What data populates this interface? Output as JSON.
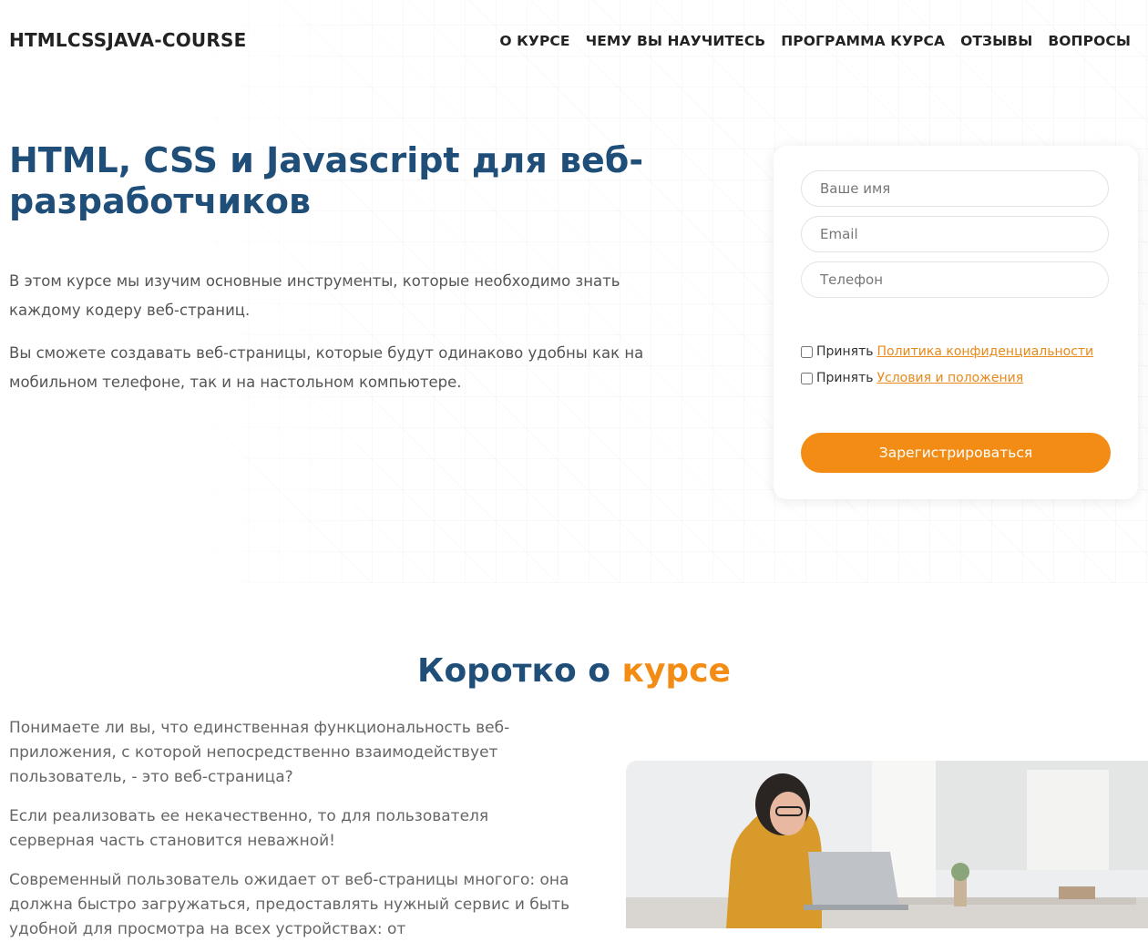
{
  "brand": "HTMLCSSJAVA-COURSE",
  "nav": {
    "items": [
      "О КУРСЕ",
      "ЧЕМУ ВЫ НАУЧИТЕСЬ",
      "ПРОГРАММА КУРСА",
      "ОТЗЫВЫ",
      "ВОПРОСЫ"
    ]
  },
  "hero": {
    "title": "HTML, CSS и Javascript для веб-разработчиков",
    "paragraphs": [
      "В этом курсе мы изучим основные инструменты, которые необходимо знать каждому кодеру веб-страниц.",
      "Вы сможете создавать веб-страницы, которые будут одинаково удобны как на мобильном телефоне, так и на настольном компьютере."
    ]
  },
  "form": {
    "name_placeholder": "Ваше имя",
    "email_placeholder": "Email",
    "phone_placeholder": "Телефон",
    "accept_label": "Принять",
    "privacy_link": "Политика конфиденциальности",
    "terms_link": "Условия и положения",
    "submit_label": "Зарегистрироваться"
  },
  "about": {
    "title_main": "Коротко о",
    "title_accent": "курсе",
    "paragraphs": [
      "Понимаете ли вы, что единственная функциональность веб-приложения, с которой непосредственно взаимодействует пользователь, - это веб-страница?",
      "Если реализовать ее некачественно, то для пользователя серверная часть становится неважной!",
      "Современный пользователь ожидает от веб-страницы многого: она должна быстро загружаться, предоставлять нужный сервис и быть удобной для просмотра на всех устройствах: от"
    ]
  },
  "colors": {
    "primary": "#1f4e79",
    "accent": "#f28c14"
  }
}
